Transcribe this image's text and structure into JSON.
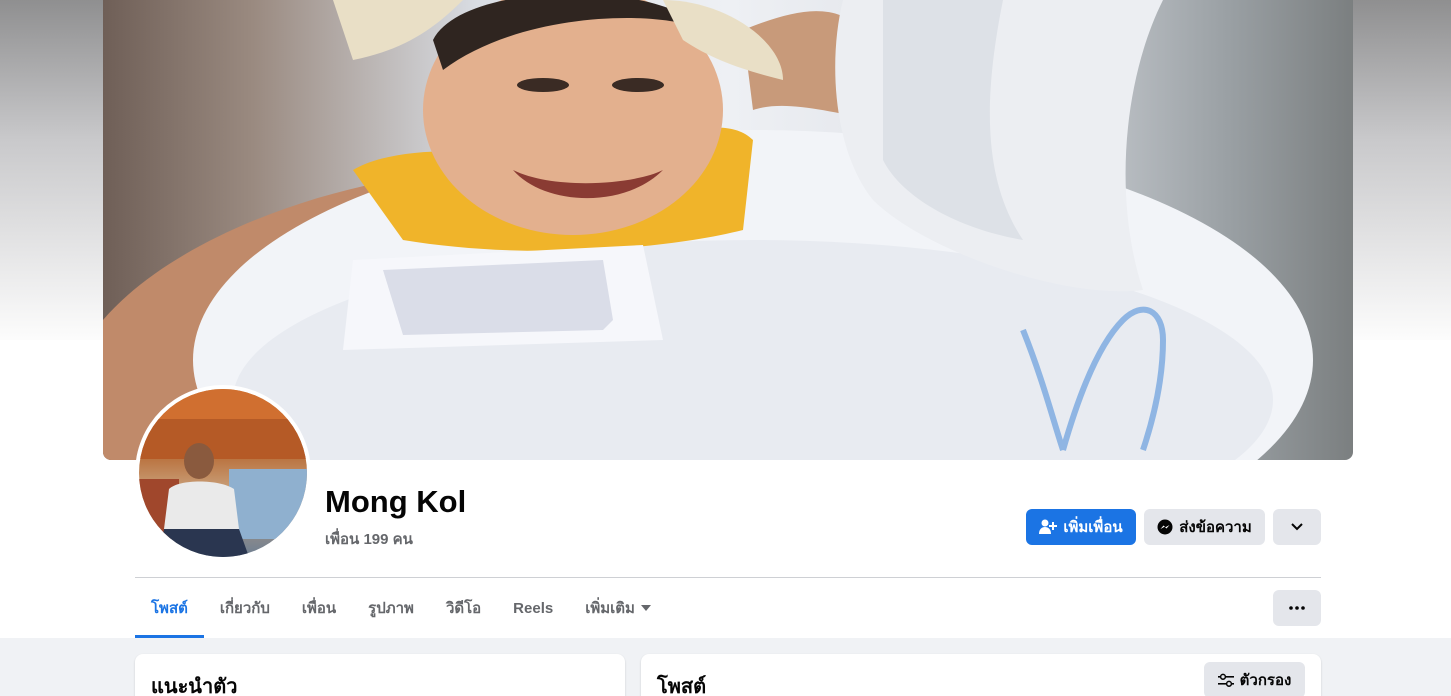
{
  "profile": {
    "name": "Mong Kol",
    "friends_label": "เพื่อน 199 คน"
  },
  "actions": {
    "add_friend_label": "เพิ่มเพื่อน",
    "add_friend_icon": "add-friend-icon",
    "message_label": "ส่งข้อความ",
    "message_icon": "messenger-icon",
    "more_icon": "chevron-down-icon"
  },
  "tabs": [
    {
      "label": "โพสต์",
      "active": true
    },
    {
      "label": "เกี่ยวกับ",
      "active": false
    },
    {
      "label": "เพื่อน",
      "active": false
    },
    {
      "label": "รูปภาพ",
      "active": false
    },
    {
      "label": "วิดีโอ",
      "active": false
    },
    {
      "label": "Reels",
      "active": false
    },
    {
      "label": "เพิ่มเติม",
      "active": false
    }
  ],
  "tabs_more_icon": "caret-down-icon",
  "tabs_overflow_icon": "ellipsis-icon",
  "intro": {
    "title": "แนะนำตัว"
  },
  "posts": {
    "title": "โพสต์",
    "filter_label": "ตัวกรอง",
    "filter_icon": "sliders-icon"
  },
  "colors": {
    "primary": "#1b74e4",
    "secondary_bg": "#e4e6eb",
    "text": "#050505",
    "muted": "#65676b",
    "page_bg": "#f0f2f5"
  }
}
